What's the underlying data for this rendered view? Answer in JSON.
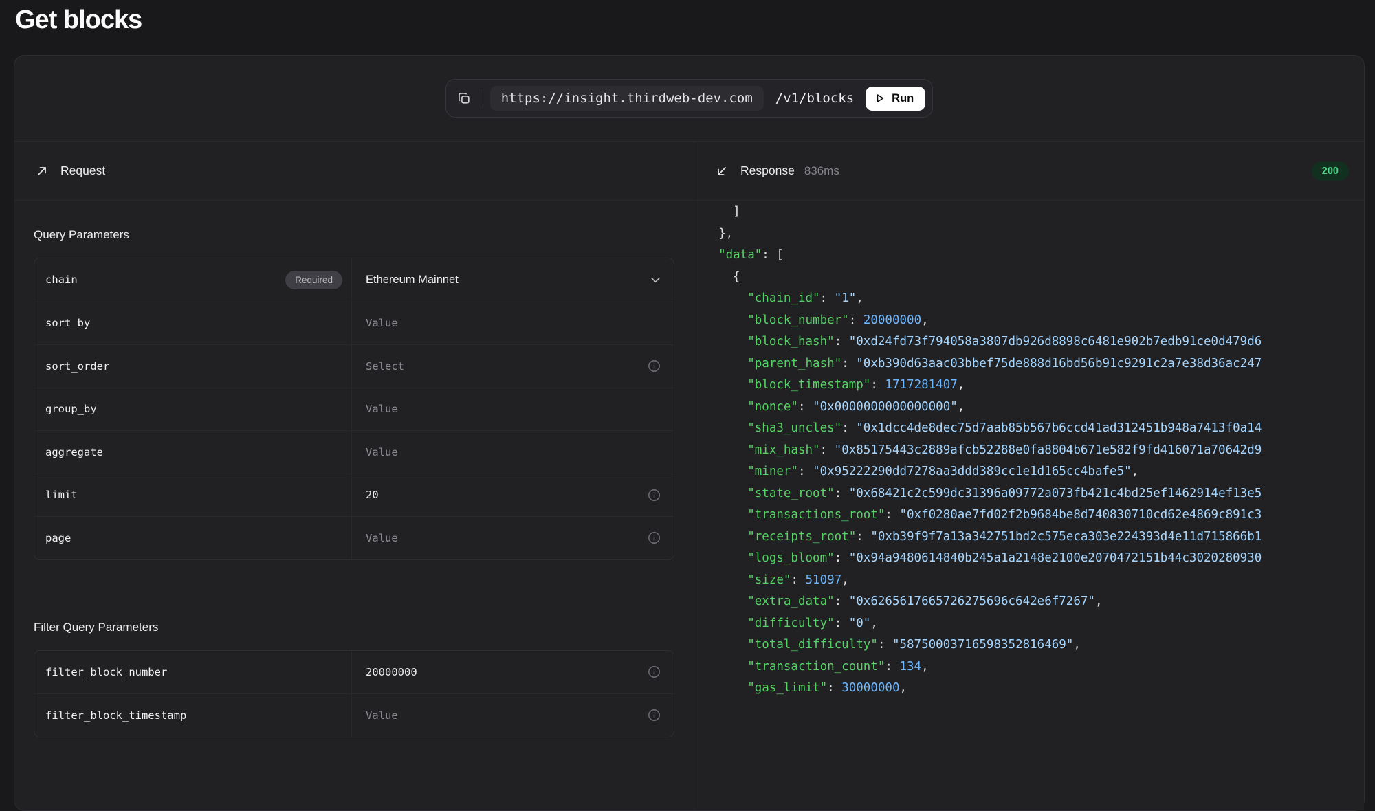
{
  "page": {
    "title": "Get blocks"
  },
  "colors": {
    "key_green": "#56d364",
    "string_blue": "#a5d6ff",
    "number_blue": "#6cb6ff",
    "status_green": "#4ed287",
    "status_green_bg": "#123020"
  },
  "url_bar": {
    "copy_icon": "copy-icon",
    "base_url": "https://insight.thirdweb-dev.com",
    "path": "/v1/blocks",
    "run_label": "Run",
    "run_icon": "play-icon"
  },
  "request": {
    "title": "Request",
    "icon": "arrow-up-right-icon",
    "sections": [
      {
        "heading": "Query Parameters",
        "rows": [
          {
            "key": "chain",
            "badge": "Required",
            "value": "Ethereum Mainnet",
            "style": "pv-sel",
            "icon": "chevron-down"
          },
          {
            "key": "sort_by",
            "value": "Value",
            "style": "pv-ph",
            "icon": ""
          },
          {
            "key": "sort_order",
            "value": "Select",
            "style": "pv-ph",
            "icon": "info"
          },
          {
            "key": "group_by",
            "value": "Value",
            "style": "pv-ph",
            "icon": ""
          },
          {
            "key": "aggregate",
            "value": "Value",
            "style": "pv-ph",
            "icon": ""
          },
          {
            "key": "limit",
            "value": "20",
            "style": "pv-f",
            "icon": "info"
          },
          {
            "key": "page",
            "value": "Value",
            "style": "pv-ph",
            "icon": "info"
          }
        ]
      },
      {
        "heading": "Filter Query Parameters",
        "rows": [
          {
            "key": "filter_block_number",
            "value": "20000000",
            "style": "pv-f",
            "icon": "info"
          },
          {
            "key": "filter_block_timestamp",
            "value": "Value",
            "style": "pv-ph",
            "icon": "info"
          }
        ]
      }
    ]
  },
  "response": {
    "title": "Response",
    "icon": "arrow-down-left-icon",
    "duration": "836ms",
    "status_code": "200",
    "code_lines": [
      "    ]",
      "  },",
      "  \"data\": [",
      "    {",
      "      \"chain_id\": \"1\",",
      "      \"block_number\": 20000000,",
      "      \"block_hash\": \"0xd24fd73f794058a3807db926d8898c6481e902b7edb91ce0d479d6",
      "      \"parent_hash\": \"0xb390d63aac03bbef75de888d16bd56b91c9291c2a7e38d36ac247",
      "      \"block_timestamp\": 1717281407,",
      "      \"nonce\": \"0x0000000000000000\",",
      "      \"sha3_uncles\": \"0x1dcc4de8dec75d7aab85b567b6ccd41ad312451b948a7413f0a14",
      "      \"mix_hash\": \"0x85175443c2889afcb52288e0fa8804b671e582f9fd416071a70642d9",
      "      \"miner\": \"0x95222290dd7278aa3ddd389cc1e1d165cc4bafe5\",",
      "      \"state_root\": \"0x68421c2c599dc31396a09772a073fb421c4bd25ef1462914ef13e5",
      "      \"transactions_root\": \"0xf0280ae7fd02f2b9684be8d740830710cd62e4869c891c3",
      "      \"receipts_root\": \"0xb39f9f7a13a342751bd2c575eca303e224393d4e11d715866b1",
      "      \"logs_bloom\": \"0x94a9480614840b245a1a2148e2100e2070472151b44c3020280930",
      "      \"size\": 51097,",
      "      \"extra_data\": \"0x6265617665726275696c642e6f7267\",",
      "      \"difficulty\": \"0\",",
      "      \"total_difficulty\": \"58750003716598352816469\",",
      "      \"transaction_count\": 134,",
      "      \"gas_limit\": 30000000,"
    ]
  }
}
